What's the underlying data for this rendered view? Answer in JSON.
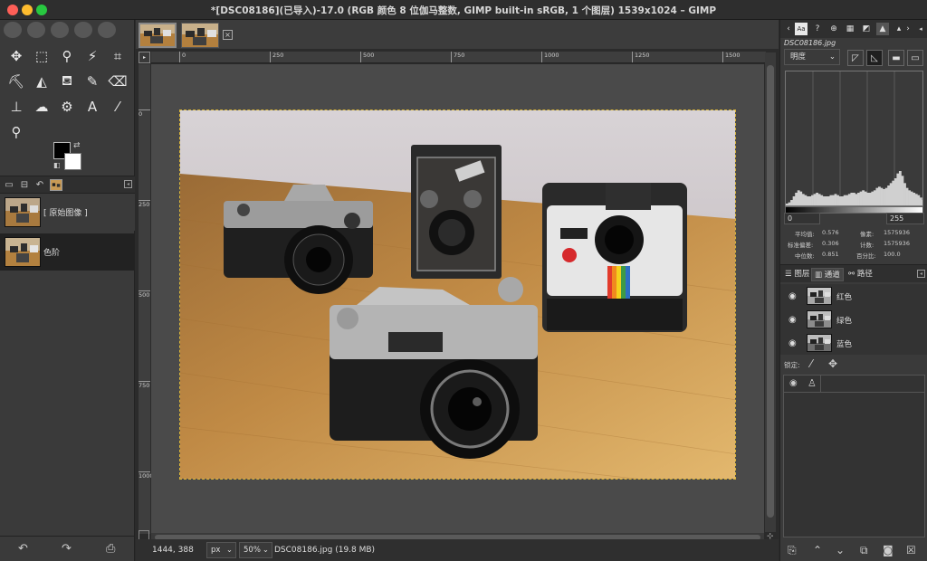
{
  "window": {
    "title": "*[DSC08186](已导入)-17.0 (RGB 颜色 8 位伽马整数, GIMP built-in sRGB, 1 个图层) 1539x1024 – GIMP"
  },
  "toolbox": {
    "tools": [
      {
        "icon": "✥",
        "name": "move-tool-icon"
      },
      {
        "icon": "⬚",
        "name": "rect-select-tool-icon"
      },
      {
        "icon": "⚲",
        "name": "lasso-tool-icon"
      },
      {
        "icon": "⚡",
        "name": "fuzzy-select-tool-icon"
      },
      {
        "icon": "⌗",
        "name": "crop-tool-icon"
      },
      {
        "icon": "⛏",
        "name": "warp-tool-icon"
      },
      {
        "icon": "◭",
        "name": "cage-tool-icon"
      },
      {
        "icon": "⛾",
        "name": "bucket-fill-tool-icon"
      },
      {
        "icon": "✎",
        "name": "paintbrush-tool-icon"
      },
      {
        "icon": "⌫",
        "name": "eraser-tool-icon"
      },
      {
        "icon": "⊥",
        "name": "clone-tool-icon"
      },
      {
        "icon": "☁",
        "name": "smudge-tool-icon"
      },
      {
        "icon": "⚙",
        "name": "paths-tool-icon"
      },
      {
        "icon": "A",
        "name": "text-tool-icon"
      },
      {
        "icon": "⁄",
        "name": "color-picker-tool-icon"
      },
      {
        "icon": "⚲",
        "name": "zoom-tool-icon"
      }
    ]
  },
  "history": {
    "items": [
      {
        "label": "[ 原始图像 ]"
      },
      {
        "label": "色阶"
      }
    ]
  },
  "image_tabs": {
    "close_label": "×"
  },
  "ruler": {
    "h_marks": [
      "0",
      "250",
      "500",
      "750",
      "1000",
      "1250",
      "1500"
    ],
    "v_marks": [
      "0",
      "250",
      "500",
      "750",
      "1000"
    ]
  },
  "statusbar": {
    "coords": "1444, 388",
    "unit": "px",
    "zoom": "50%",
    "file_info": "DSC08186.jpg (19.8 MB)"
  },
  "histogram_panel": {
    "file_name": "DSC08186.jpg",
    "channel": "明度",
    "range_min": "0",
    "range_max": "255",
    "stats": {
      "mean_label": "平均值:",
      "mean": "0.576",
      "pixels_label": "像素:",
      "pixels": "1575936",
      "std_label": "标准偏差:",
      "std": "0.306",
      "count_label": "计数:",
      "count": "1575936",
      "median_label": "中位数:",
      "median": "0.851",
      "percent_label": "百分比:",
      "percent": "100.0"
    },
    "bins": [
      3,
      4,
      6,
      9,
      12,
      14,
      13,
      11,
      10,
      9,
      9,
      10,
      11,
      12,
      11,
      10,
      9,
      9,
      9,
      10,
      10,
      11,
      10,
      9,
      9,
      10,
      10,
      11,
      12,
      12,
      11,
      12,
      13,
      14,
      13,
      12,
      12,
      13,
      14,
      16,
      17,
      16,
      15,
      16,
      18,
      20,
      22,
      24,
      28,
      30,
      26,
      20,
      16,
      14,
      13,
      12,
      11,
      10,
      8,
      6
    ]
  },
  "layer_tabs": {
    "layers": "图层",
    "channels": "通道",
    "paths": "路径"
  },
  "channels": [
    {
      "label": "红色"
    },
    {
      "label": "绿色"
    },
    {
      "label": "蓝色"
    }
  ],
  "lock_label": "锁定:"
}
